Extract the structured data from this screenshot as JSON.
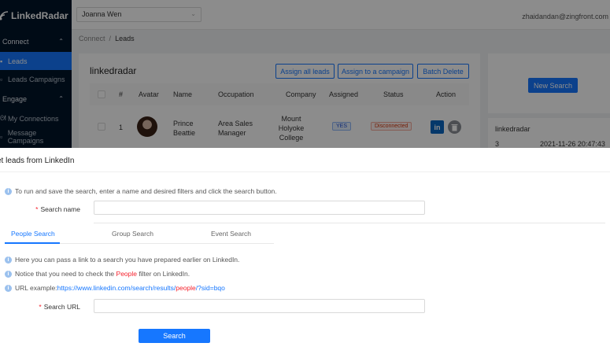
{
  "app": {
    "name": "LinkedRadar"
  },
  "sidebar": {
    "connect_label": "Connect",
    "leads_label": "Leads",
    "leads_campaigns_label": "Leads Campaigns",
    "engage_label": "Engage",
    "my_connections_label": "My Connections",
    "message_campaigns_label": "Message Campaigns"
  },
  "topbar": {
    "account": "Joanna Wen",
    "email": "zhaidandan@zingfront.com"
  },
  "breadcrumb": {
    "parent": "Connect",
    "separator": "/",
    "current": "Leads"
  },
  "leads_panel": {
    "title": "linkedradar",
    "buttons": {
      "assign_all": "Assign all leads",
      "assign_campaign": "Assign to a campaign",
      "batch_delete": "Batch Delete"
    },
    "columns": [
      "#",
      "Avatar",
      "Name",
      "Occupation",
      "Company",
      "Assigned",
      "Status",
      "Action"
    ],
    "rows": [
      {
        "index": "1",
        "name_line1": "Prince",
        "name_line2": "Beattie",
        "occ_line1": "Area Sales",
        "occ_line2": "Manager",
        "company_line1": "Mount",
        "company_line2": "Holyoke",
        "company_line3": "College",
        "assigned": "YES",
        "status": "Disconnected",
        "linkedin_glyph": "in"
      }
    ]
  },
  "right_panel": {
    "new_search_label": "New Search",
    "search_name": "linkedradar",
    "count": "3",
    "timestamp": "2021-11-26 20:47:43"
  },
  "modal": {
    "title": "et leads from LinkedIn",
    "intro": "To run and save the search, enter a name and desired filters and click the search button.",
    "search_name_label": "Search name",
    "search_name_value": "",
    "tabs": [
      "People Search",
      "Group Search",
      "Event Search"
    ],
    "hint1": "Here you can pass a link to a search you have prepared earlier on LinkedIn.",
    "hint2_pre": "Notice that you need to check the ",
    "hint2_highlight": "People",
    "hint2_post": " filter on LinkedIn.",
    "hint3_label": "URL example:",
    "hint3_url_pre": "https://www.linkedin.com/search/results/",
    "hint3_url_highlight": "people",
    "hint3_url_post": "/?sid=bqo",
    "search_url_label": "Search URL",
    "search_url_value": "",
    "search_button": "Search",
    "required_mark": "*"
  },
  "colors": {
    "primary": "#1677ff",
    "sidebar_bg": "#001529",
    "danger": "#f5222d",
    "linkedin": "#0a66c2"
  }
}
